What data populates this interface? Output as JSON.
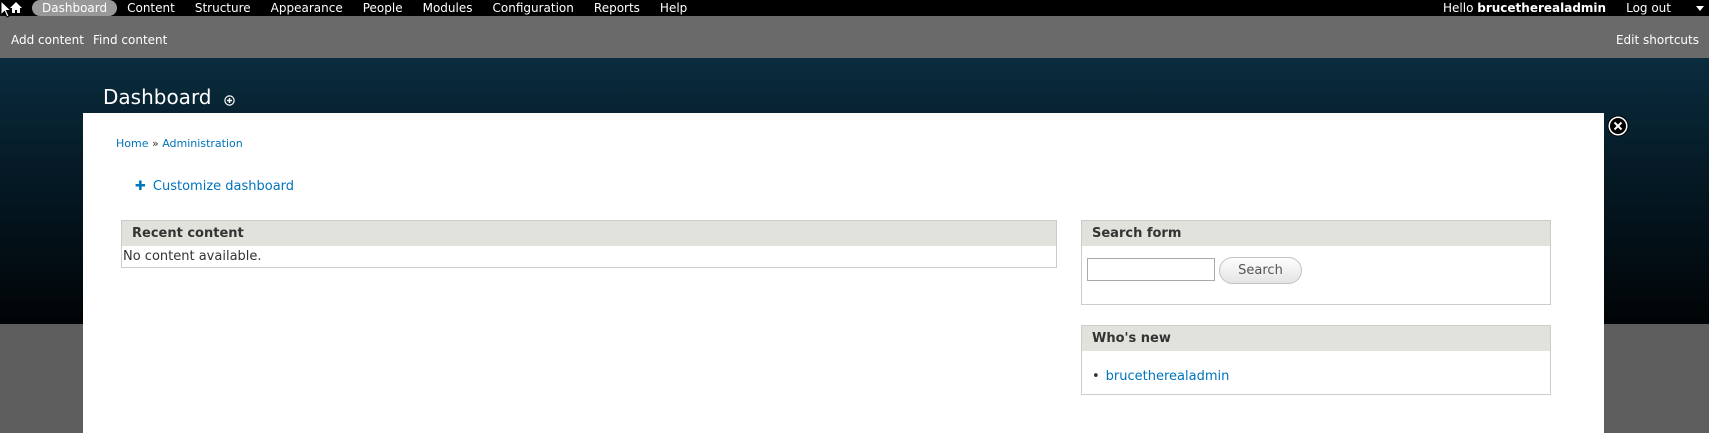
{
  "toolbar": {
    "menu": [
      "Dashboard",
      "Content",
      "Structure",
      "Appearance",
      "People",
      "Modules",
      "Configuration",
      "Reports",
      "Help"
    ],
    "active_item": "Dashboard",
    "hello_prefix": "Hello",
    "username": "brucetherealadmin",
    "logout": "Log out"
  },
  "shortcuts": {
    "items": [
      "Add content",
      "Find content"
    ],
    "edit": "Edit shortcuts"
  },
  "page": {
    "title": "Dashboard"
  },
  "breadcrumb": {
    "items": [
      "Home",
      "Administration"
    ],
    "separator": "»"
  },
  "customize_link": "Customize dashboard",
  "blocks": {
    "recent_content": {
      "title": "Recent content",
      "empty_text": "No content available."
    },
    "search_form": {
      "title": "Search form",
      "input_value": "",
      "button_label": "Search"
    },
    "whos_new": {
      "title": "Who's new",
      "users": [
        "brucetherealadmin"
      ]
    }
  },
  "colors": {
    "link": "#0074bd",
    "block_header": "#e1e2dc",
    "toolbar": "#000000",
    "shortcuts_bar": "#6a6a6a"
  }
}
